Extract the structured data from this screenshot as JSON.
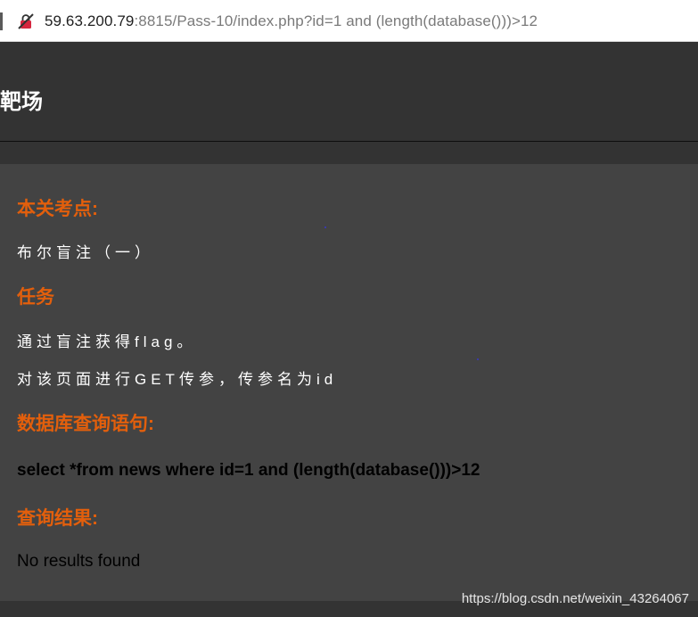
{
  "browser": {
    "url_host": "59.63.200.79",
    "url_rest": ":8815/Pass-10/index.php?id=1 and (length(database()))>12"
  },
  "header": {
    "site_title": "靶场"
  },
  "content": {
    "section1_heading": "本关考点:",
    "section1_text": "布尔盲注（一）",
    "section2_heading": "任务",
    "section2_line1": "通过盲注获得flag。",
    "section2_line2": "对该页面进行GET传参，传参名为id",
    "section3_heading": "数据库查询语句:",
    "query": "select *from news where id=1 and (length(database()))>12",
    "section4_heading": "查询结果:",
    "result": "No results found"
  },
  "watermark": "https://blog.csdn.net/weixin_43264067",
  "colors": {
    "heading": "#e35f0c",
    "panel_bg": "#434343",
    "header_bg": "#333333"
  },
  "icons": {
    "address_bar_lock": "insecure-lock-icon"
  }
}
